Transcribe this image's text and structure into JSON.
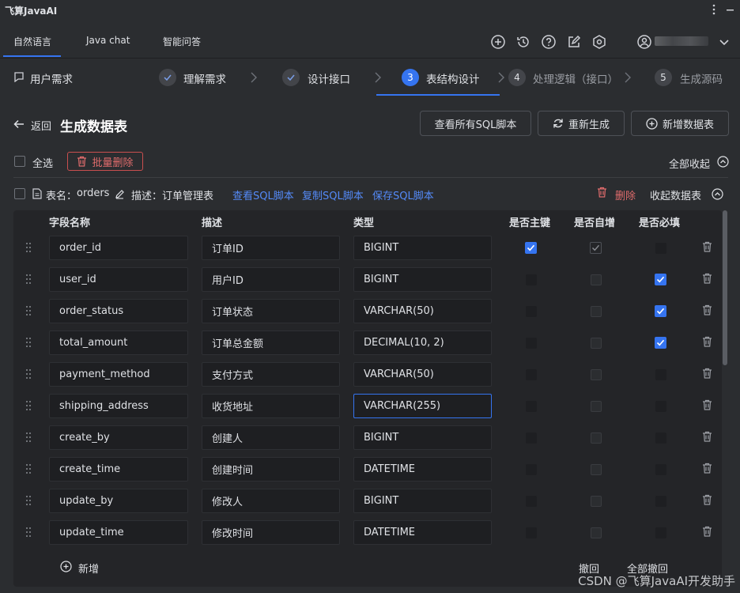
{
  "app_title": "飞算JavaAI",
  "tabs": [
    {
      "label": "自然语言",
      "active": true
    },
    {
      "label": "Java chat",
      "active": false
    },
    {
      "label": "智能问答",
      "active": false
    }
  ],
  "requirement_label": "用户需求",
  "steps": [
    {
      "number": "✓",
      "label": "理解需求",
      "state": "done"
    },
    {
      "number": "✓",
      "label": "设计接口",
      "state": "done"
    },
    {
      "number": "3",
      "label": "表结构设计",
      "state": "active"
    },
    {
      "number": "4",
      "label": "处理逻辑（接口）",
      "state": "pending"
    },
    {
      "number": "5",
      "label": "生成源码",
      "state": "pending"
    }
  ],
  "header": {
    "back_label": "返回",
    "title": "生成数据表",
    "view_sql_label": "查看所有SQL脚本",
    "regenerate_label": "重新生成",
    "add_table_label": "新增数据表"
  },
  "toolbar": {
    "select_all_label": "全选",
    "batch_delete_label": "批量删除",
    "collapse_all_label": "全部收起"
  },
  "table_card": {
    "name_prefix": "表名：",
    "name": "orders",
    "desc_prefix": "描述：",
    "desc": "订单管理表",
    "view_sql": "查看SQL脚本",
    "copy_sql": "复制SQL脚本",
    "save_sql": "保存SQL脚本",
    "delete_label": "删除",
    "collapse_label": "收起数据表"
  },
  "columns": {
    "field": "字段名称",
    "desc": "描述",
    "type": "类型",
    "pk": "是否主键",
    "auto": "是否自增",
    "required": "是否必填"
  },
  "rows": [
    {
      "field": "order_id",
      "desc": "订单ID",
      "type": "BIGINT",
      "pk": true,
      "auto": true,
      "required": false
    },
    {
      "field": "user_id",
      "desc": "用户ID",
      "type": "BIGINT",
      "pk": false,
      "auto": false,
      "required": true
    },
    {
      "field": "order_status",
      "desc": "订单状态",
      "type": "VARCHAR(50)",
      "pk": false,
      "auto": false,
      "required": true
    },
    {
      "field": "total_amount",
      "desc": "订单总金额",
      "type": "DECIMAL(10, 2)",
      "pk": false,
      "auto": false,
      "required": true
    },
    {
      "field": "payment_method",
      "desc": "支付方式",
      "type": "VARCHAR(50)",
      "pk": false,
      "auto": false,
      "required": false
    },
    {
      "field": "shipping_address",
      "desc": "收货地址",
      "type": "VARCHAR(255)",
      "pk": false,
      "auto": false,
      "required": false,
      "focused": true
    },
    {
      "field": "create_by",
      "desc": "创建人",
      "type": "BIGINT",
      "pk": false,
      "auto": false,
      "required": false
    },
    {
      "field": "create_time",
      "desc": "创建时间",
      "type": "DATETIME",
      "pk": false,
      "auto": false,
      "required": false
    },
    {
      "field": "update_by",
      "desc": "修改人",
      "type": "BIGINT",
      "pk": false,
      "auto": false,
      "required": false
    },
    {
      "field": "update_time",
      "desc": "修改时间",
      "type": "DATETIME",
      "pk": false,
      "auto": false,
      "required": false
    }
  ],
  "footer": {
    "add_label": "新增",
    "undo_label": "撤回",
    "undo_all_label": "全部撤回"
  },
  "watermark": "CSDN @飞算JavaAI开发助手",
  "colors": {
    "accent": "#3574f0",
    "danger": "#e06c6c",
    "link": "#548af7"
  }
}
